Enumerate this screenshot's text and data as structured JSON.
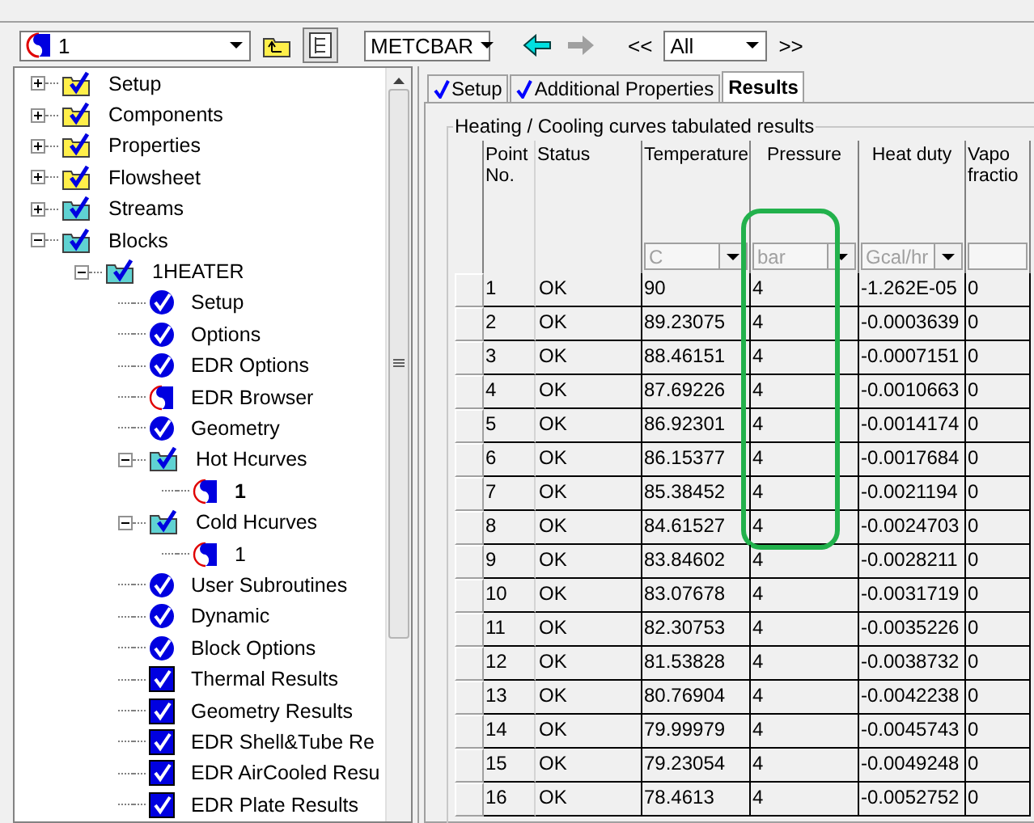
{
  "toolbar": {
    "block_select": "1",
    "tree_toggle": {
      "pressed": true
    },
    "units": "METCBAR",
    "back_arrow": {
      "disabled": false
    },
    "forward_arrow": {
      "disabled": true
    },
    "nav_back": "<<",
    "filter": "All",
    "nav_forward": ">>"
  },
  "tree": [
    {
      "label": "Setup",
      "kind": "folder",
      "expanded": false,
      "selected": false
    },
    {
      "label": "Components",
      "kind": "folder",
      "expanded": false,
      "selected": false
    },
    {
      "label": "Properties",
      "kind": "folder",
      "expanded": false,
      "selected": false
    },
    {
      "label": "Flowsheet",
      "kind": "folder",
      "expanded": false,
      "selected": false
    },
    {
      "label": "Streams",
      "kind": "subfolder",
      "expanded": false,
      "selected": false
    },
    {
      "label": "Blocks",
      "kind": "subfolder",
      "expanded": true,
      "selected": false,
      "children": [
        {
          "label": "1HEATER",
          "kind": "subfolder",
          "expanded": true,
          "selected": false,
          "children": [
            {
              "label": "Setup",
              "kind": "form",
              "selected": false
            },
            {
              "label": "Options",
              "kind": "form",
              "selected": false
            },
            {
              "label": "EDR Options",
              "kind": "form",
              "selected": false
            },
            {
              "label": "EDR Browser",
              "kind": "incomplete",
              "selected": false
            },
            {
              "label": "Geometry",
              "kind": "form",
              "selected": false
            },
            {
              "label": "Hot Hcurves",
              "kind": "subfolder",
              "expanded": true,
              "selected": false,
              "children": [
                {
                  "label": "1",
                  "kind": "incomplete",
                  "selected": true
                }
              ]
            },
            {
              "label": "Cold Hcurves",
              "kind": "subfolder",
              "expanded": true,
              "selected": false,
              "children": [
                {
                  "label": "1",
                  "kind": "incomplete",
                  "selected": false
                }
              ]
            },
            {
              "label": "User Subroutines",
              "kind": "form",
              "selected": false
            },
            {
              "label": "Dynamic",
              "kind": "form",
              "selected": false
            },
            {
              "label": "Block Options",
              "kind": "form",
              "selected": false
            },
            {
              "label": "Thermal Results",
              "kind": "result",
              "selected": false
            },
            {
              "label": "Geometry Results",
              "kind": "result",
              "selected": false
            },
            {
              "label": "EDR Shell&Tube Re",
              "kind": "result",
              "selected": false
            },
            {
              "label": "EDR AirCooled Resu",
              "kind": "result",
              "selected": false
            },
            {
              "label": "EDR Plate Results",
              "kind": "result",
              "selected": false
            }
          ]
        }
      ]
    }
  ],
  "tabs": [
    {
      "label": "Setup",
      "complete": true,
      "selected": false
    },
    {
      "label": "Additional Properties",
      "complete": true,
      "selected": false
    },
    {
      "label": "Results",
      "complete": false,
      "selected": true
    }
  ],
  "group_title": "Heating / Cooling curves tabulated results",
  "table": {
    "columns": [
      {
        "label": "Point No.",
        "highlighted": false
      },
      {
        "label": "Status",
        "highlighted": false
      },
      {
        "label": "Temperature",
        "unit": "C",
        "highlighted": false
      },
      {
        "label": "Pressure",
        "unit": "bar",
        "highlighted": true
      },
      {
        "label": "Heat duty",
        "unit": "Gcal/hr",
        "highlighted": false
      },
      {
        "label": "Vapo fractio",
        "unit_field": true,
        "highlighted": false
      }
    ],
    "rows": [
      {
        "cells": [
          "1",
          "OK",
          "90",
          "4",
          "-1.262E-05",
          "0"
        ],
        "highlighted": true
      },
      {
        "cells": [
          "2",
          "OK",
          "89.23075",
          "4",
          "-0.0003639",
          "0"
        ],
        "highlighted": true
      },
      {
        "cells": [
          "3",
          "OK",
          "88.46151",
          "4",
          "-0.0007151",
          "0"
        ],
        "highlighted": true
      },
      {
        "cells": [
          "4",
          "OK",
          "87.69226",
          "4",
          "-0.0010663",
          "0"
        ],
        "highlighted": true
      },
      {
        "cells": [
          "5",
          "OK",
          "86.92301",
          "4",
          "-0.0014174",
          "0"
        ],
        "highlighted": true
      },
      {
        "cells": [
          "6",
          "OK",
          "86.15377",
          "4",
          "-0.0017684",
          "0"
        ],
        "highlighted": true
      },
      {
        "cells": [
          "7",
          "OK",
          "85.38452",
          "4",
          "-0.0021194",
          "0"
        ],
        "highlighted": true
      },
      {
        "cells": [
          "8",
          "OK",
          "84.61527",
          "4",
          "-0.0024703",
          "0"
        ],
        "highlighted": true
      },
      {
        "cells": [
          "9",
          "OK",
          "83.84602",
          "4",
          "-0.0028211",
          "0"
        ],
        "highlighted": false
      },
      {
        "cells": [
          "10",
          "OK",
          "83.07678",
          "4",
          "-0.0031719",
          "0"
        ],
        "highlighted": false
      },
      {
        "cells": [
          "11",
          "OK",
          "82.30753",
          "4",
          "-0.0035226",
          "0"
        ],
        "highlighted": false
      },
      {
        "cells": [
          "12",
          "OK",
          "81.53828",
          "4",
          "-0.0038732",
          "0"
        ],
        "highlighted": false
      },
      {
        "cells": [
          "13",
          "OK",
          "80.76904",
          "4",
          "-0.0042238",
          "0"
        ],
        "highlighted": false
      },
      {
        "cells": [
          "14",
          "OK",
          "79.99979",
          "4",
          "-0.0045743",
          "0"
        ],
        "highlighted": false
      },
      {
        "cells": [
          "15",
          "OK",
          "79.23054",
          "4",
          "-0.0049248",
          "0"
        ],
        "highlighted": false
      },
      {
        "cells": [
          "16",
          "OK",
          "78.4613",
          "4",
          "-0.0052752",
          "0"
        ],
        "highlighted": false
      }
    ]
  }
}
